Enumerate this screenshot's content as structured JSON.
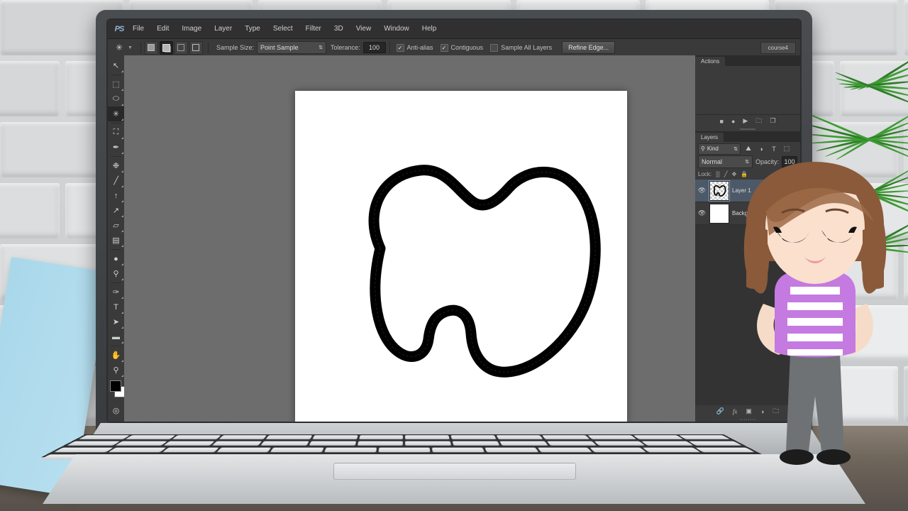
{
  "app": {
    "name": "Adobe Photoshop",
    "logo_text": "PS",
    "workspace_label": "course4"
  },
  "menubar": {
    "items": [
      {
        "label": "File"
      },
      {
        "label": "Edit"
      },
      {
        "label": "Image"
      },
      {
        "label": "Layer"
      },
      {
        "label": "Type"
      },
      {
        "label": "Select"
      },
      {
        "label": "Filter"
      },
      {
        "label": "3D"
      },
      {
        "label": "View"
      },
      {
        "label": "Window"
      },
      {
        "label": "Help"
      }
    ]
  },
  "options_bar": {
    "active_tool_icon": "magic-wand-icon",
    "selection_modes": [
      {
        "name": "new-selection",
        "active": false
      },
      {
        "name": "add-to-selection",
        "active": true
      },
      {
        "name": "subtract-from-selection",
        "active": false
      },
      {
        "name": "intersect-with-selection",
        "active": false
      }
    ],
    "sample_size_label": "Sample Size:",
    "sample_size_value": "Point Sample",
    "tolerance_label": "Tolerance:",
    "tolerance_value": "100",
    "anti_alias_label": "Anti-alias",
    "anti_alias_checked": true,
    "contiguous_label": "Contiguous",
    "contiguous_checked": true,
    "sample_all_layers_label": "Sample All Layers",
    "sample_all_layers_checked": false,
    "refine_edge_label": "Refine Edge..."
  },
  "toolbox": {
    "tools": [
      {
        "name": "move-tool",
        "glyph": "↖",
        "active": false
      },
      {
        "name": "rectangular-marquee-tool",
        "glyph": "⬚",
        "active": false
      },
      {
        "name": "lasso-tool",
        "glyph": "⬭",
        "active": false
      },
      {
        "name": "magic-wand-tool",
        "glyph": "✳",
        "active": true
      },
      {
        "name": "crop-tool",
        "glyph": "⛶",
        "active": false
      },
      {
        "name": "eyedropper-tool",
        "glyph": "✒",
        "active": false
      },
      {
        "name": "spot-healing-brush-tool",
        "glyph": "❉",
        "active": false
      },
      {
        "name": "brush-tool",
        "glyph": "╱",
        "active": false
      },
      {
        "name": "clone-stamp-tool",
        "glyph": "↑",
        "active": false
      },
      {
        "name": "history-brush-tool",
        "glyph": "↗",
        "active": false
      },
      {
        "name": "eraser-tool",
        "glyph": "▱",
        "active": false
      },
      {
        "name": "gradient-tool",
        "glyph": "▤",
        "active": false
      },
      {
        "name": "blur-tool",
        "glyph": "●",
        "active": false
      },
      {
        "name": "dodge-tool",
        "glyph": "⚲",
        "active": false
      },
      {
        "name": "pen-tool",
        "glyph": "✑",
        "active": false
      },
      {
        "name": "type-tool",
        "glyph": "T",
        "active": false
      },
      {
        "name": "path-selection-tool",
        "glyph": "➤",
        "active": false
      },
      {
        "name": "rectangle-tool",
        "glyph": "▬",
        "active": false
      },
      {
        "name": "hand-tool",
        "glyph": "✋",
        "active": false
      },
      {
        "name": "zoom-tool",
        "glyph": "⚲",
        "active": false
      }
    ],
    "foreground_color": "#000000",
    "background_color": "#ffffff",
    "quick_mask_name": "quick-mask-mode-button",
    "screen_mode_name": "screen-mode-button"
  },
  "actions_panel": {
    "tab_label": "Actions",
    "footer_buttons": [
      {
        "name": "stop-button",
        "glyph": "■"
      },
      {
        "name": "record-button",
        "glyph": "●"
      },
      {
        "name": "play-button",
        "glyph": "▶"
      },
      {
        "name": "new-set-button",
        "glyph": "🗀"
      },
      {
        "name": "new-action-button",
        "glyph": "❐"
      }
    ]
  },
  "layers_panel": {
    "tab_label": "Layers",
    "filter_kind_label": "Kind",
    "filter_icons": [
      {
        "name": "filter-pixel-layers-icon",
        "glyph": "⛰"
      },
      {
        "name": "filter-adjustment-layers-icon",
        "glyph": "◑"
      },
      {
        "name": "filter-type-layers-icon",
        "glyph": "T"
      },
      {
        "name": "filter-shape-layers-icon",
        "glyph": "⬚"
      }
    ],
    "blend_mode": "Normal",
    "opacity_label": "Opacity:",
    "opacity_value": "100",
    "lock_label": "Lock:",
    "lock_icons": [
      {
        "name": "lock-transparent-pixels-icon",
        "glyph": "▒"
      },
      {
        "name": "lock-image-pixels-icon",
        "glyph": "╱"
      },
      {
        "name": "lock-position-icon",
        "glyph": "✥"
      },
      {
        "name": "lock-all-icon",
        "glyph": "🔒"
      }
    ],
    "layers": [
      {
        "name": "Layer 1",
        "visible": true,
        "selected": true,
        "thumb": "transparent"
      },
      {
        "name": "Background",
        "visible": true,
        "selected": false,
        "thumb": "white"
      }
    ],
    "footer_buttons": [
      {
        "name": "link-layers-button",
        "glyph": "🔗"
      },
      {
        "name": "layer-style-button",
        "glyph": "fx"
      },
      {
        "name": "add-layer-mask-button",
        "glyph": "▣"
      },
      {
        "name": "new-adjustment-layer-button",
        "glyph": "◑"
      },
      {
        "name": "new-group-button",
        "glyph": "🗀"
      }
    ]
  },
  "canvas": {
    "document_background": "#ffffff",
    "artwork_description": "black outlined blob shape with active marching-ants selection inside",
    "cursor": "magic-wand-cursor"
  },
  "scene": {
    "background": "grey stone brick wall",
    "floor_color": "#6e655b",
    "laptop_color": "#cfd2d4",
    "board_color": "#a9d8ea",
    "plant_color": "#3f9b35",
    "character": {
      "name": "cartoon-instructor",
      "hair_color": "#8a5a3b",
      "skin_color": "#f6dcc8",
      "shirt_color": "#c47ae0",
      "shirt_stripe_color": "#ffffff",
      "pants_color": "#6e7275",
      "shoe_color": "#1c1c1c"
    }
  }
}
